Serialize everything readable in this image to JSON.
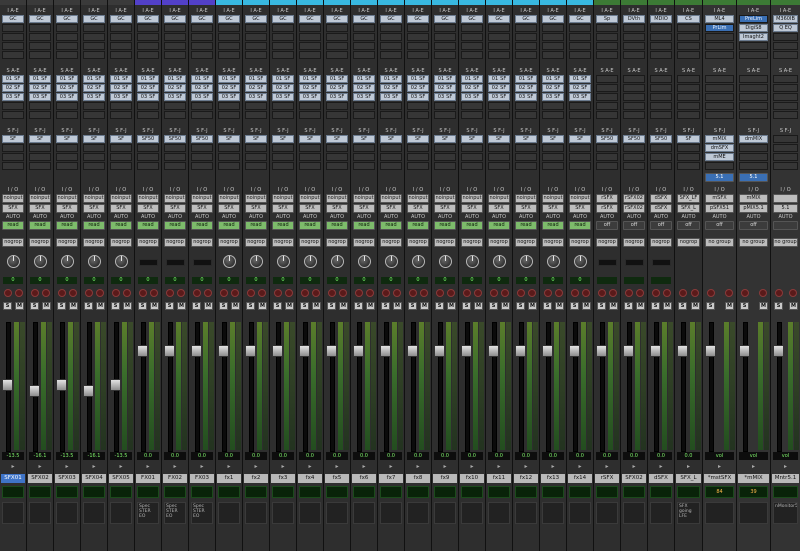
{
  "strips": [
    {
      "name": "SFX01",
      "color": "#3a3a3a",
      "selected": true,
      "inserts": [
        "GC",
        "",
        ""
      ],
      "sends_top": [
        "SF",
        "SF",
        "SF"
      ],
      "send_ids": [
        "01",
        "02",
        "03"
      ],
      "sendsF": [
        "SF"
      ],
      "input": "noinput",
      "output": "SFX",
      "auto": "AUTO",
      "mode": "read",
      "group": "nogrop",
      "pan": "0",
      "volume": "-13.5",
      "knob": true,
      "comment": ""
    },
    {
      "name": "SFX02",
      "color": "#3a3a3a",
      "inserts": [
        "GC",
        "",
        ""
      ],
      "sends_top": [
        "SF",
        "SF",
        "SF"
      ],
      "send_ids": [
        "01",
        "02",
        "03"
      ],
      "sendsF": [
        "SF"
      ],
      "input": "noinput",
      "output": "SFX",
      "auto": "AUTO",
      "mode": "read",
      "group": "nogrop",
      "pan": "0",
      "volume": "-16.1",
      "knob": true,
      "comment": ""
    },
    {
      "name": "SFX03",
      "color": "#3a3a3a",
      "inserts": [
        "GC",
        "",
        ""
      ],
      "sends_top": [
        "SF",
        "SF",
        "SF"
      ],
      "send_ids": [
        "01",
        "02",
        "03"
      ],
      "sendsF": [
        "SF"
      ],
      "input": "noinput",
      "output": "SFX",
      "auto": "AUTO",
      "mode": "read",
      "group": "nogrop",
      "pan": "0",
      "volume": "-13.5",
      "knob": true,
      "comment": ""
    },
    {
      "name": "SFX04",
      "color": "#3a3a3a",
      "inserts": [
        "GC",
        "",
        ""
      ],
      "sends_top": [
        "SF",
        "SF",
        "SF"
      ],
      "send_ids": [
        "01",
        "02",
        "03"
      ],
      "sendsF": [
        "SF"
      ],
      "input": "noinput",
      "output": "SFX",
      "auto": "AUTO",
      "mode": "read",
      "group": "nogrop",
      "pan": "0",
      "volume": "-16.1",
      "knob": true,
      "comment": ""
    },
    {
      "name": "SFX05",
      "color": "#3a3a3a",
      "inserts": [
        "GC",
        "",
        ""
      ],
      "sends_top": [
        "SF",
        "SF",
        "SF"
      ],
      "send_ids": [
        "01",
        "02",
        "03"
      ],
      "sendsF": [
        "SF"
      ],
      "input": "noinput",
      "output": "SFX",
      "auto": "AUTO",
      "mode": "read",
      "group": "nogrop",
      "pan": "0",
      "volume": "-13.5",
      "knob": true,
      "comment": ""
    },
    {
      "name": "FX01",
      "color": "#5240c8",
      "inserts": [
        "GC",
        "",
        ""
      ],
      "sends_top": [
        "SF",
        "SF",
        "SF"
      ],
      "send_ids": [
        "01",
        "02",
        "03"
      ],
      "sendsF": [
        "SF50"
      ],
      "input": "noinput",
      "output": "SFX",
      "auto": "AUTO",
      "mode": "read",
      "group": "nogrop",
      "pan": "0",
      "volume": "0.0",
      "knob": false,
      "comment": "Spec STER EO"
    },
    {
      "name": "FX02",
      "color": "#5240c8",
      "inserts": [
        "GC",
        "",
        ""
      ],
      "sends_top": [
        "SF",
        "SF",
        "SF"
      ],
      "send_ids": [
        "01",
        "02",
        "03"
      ],
      "sendsF": [
        "SF50"
      ],
      "input": "noinput",
      "output": "SFX",
      "auto": "AUTO",
      "mode": "read",
      "group": "nogrop",
      "pan": "0",
      "volume": "0.0",
      "knob": false,
      "comment": "Spec STER EO"
    },
    {
      "name": "FX03",
      "color": "#5240c8",
      "inserts": [
        "GC",
        "",
        ""
      ],
      "sends_top": [
        "SF",
        "SF",
        "SF"
      ],
      "send_ids": [
        "01",
        "02",
        "03"
      ],
      "sendsF": [
        "SF50"
      ],
      "input": "noinput",
      "output": "SFX",
      "auto": "AUTO",
      "mode": "read",
      "group": "nogrop",
      "pan": "0",
      "volume": "0.0",
      "knob": false,
      "comment": "Spec STER EO"
    },
    {
      "name": "fx1",
      "color": "#38b8e0",
      "inserts": [
        "GC",
        "",
        ""
      ],
      "sends_top": [
        "SF",
        "SF",
        "SF"
      ],
      "send_ids": [
        "01",
        "02",
        "03"
      ],
      "sendsF": [
        "SF"
      ],
      "input": "noinput",
      "output": "SFX",
      "auto": "AUTO",
      "mode": "read",
      "group": "nogrop",
      "pan": "0",
      "volume": "0.0",
      "knob": true,
      "comment": ""
    },
    {
      "name": "fx2",
      "color": "#38b8e0",
      "inserts": [
        "GC",
        "",
        ""
      ],
      "sends_top": [
        "SF",
        "SF",
        "SF"
      ],
      "send_ids": [
        "01",
        "02",
        "03"
      ],
      "sendsF": [
        "SF"
      ],
      "input": "noinput",
      "output": "SFX",
      "auto": "AUTO",
      "mode": "read",
      "group": "nogrop",
      "pan": "0",
      "volume": "0.0",
      "knob": true,
      "comment": ""
    },
    {
      "name": "fx3",
      "color": "#38b8e0",
      "inserts": [
        "GC",
        "",
        ""
      ],
      "sends_top": [
        "SF",
        "SF",
        "SF"
      ],
      "send_ids": [
        "01",
        "02",
        "03"
      ],
      "sendsF": [
        "SF"
      ],
      "input": "noinput",
      "output": "SFX",
      "auto": "AUTO",
      "mode": "read",
      "group": "nogrop",
      "pan": "0",
      "volume": "0.0",
      "knob": true,
      "comment": ""
    },
    {
      "name": "fx4",
      "color": "#38b8e0",
      "inserts": [
        "GC",
        "",
        ""
      ],
      "sends_top": [
        "SF",
        "SF",
        "SF"
      ],
      "send_ids": [
        "01",
        "02",
        "03"
      ],
      "sendsF": [
        "SF"
      ],
      "input": "noinput",
      "output": "SFX",
      "auto": "AUTO",
      "mode": "read",
      "group": "nogrop",
      "pan": "0",
      "volume": "0.0",
      "knob": true,
      "comment": ""
    },
    {
      "name": "fx5",
      "color": "#38b8e0",
      "inserts": [
        "GC",
        "",
        ""
      ],
      "sends_top": [
        "SF",
        "SF",
        "SF"
      ],
      "send_ids": [
        "01",
        "02",
        "03"
      ],
      "sendsF": [
        "SF"
      ],
      "input": "noinput",
      "output": "SFX",
      "auto": "AUTO",
      "mode": "read",
      "group": "nogrop",
      "pan": "0",
      "volume": "0.0",
      "knob": true,
      "comment": ""
    },
    {
      "name": "fx6",
      "color": "#38b8e0",
      "inserts": [
        "GC",
        "",
        ""
      ],
      "sends_top": [
        "SF",
        "SF",
        "SF"
      ],
      "send_ids": [
        "01",
        "02",
        "03"
      ],
      "sendsF": [
        "SF"
      ],
      "input": "noinput",
      "output": "SFX",
      "auto": "AUTO",
      "mode": "read",
      "group": "nogrop",
      "pan": "0",
      "volume": "0.0",
      "knob": true,
      "comment": ""
    },
    {
      "name": "fx7",
      "color": "#38b8e0",
      "inserts": [
        "GC",
        "",
        ""
      ],
      "sends_top": [
        "SF",
        "SF",
        "SF"
      ],
      "send_ids": [
        "01",
        "02",
        "03"
      ],
      "sendsF": [
        "SF"
      ],
      "input": "noinput",
      "output": "SFX",
      "auto": "AUTO",
      "mode": "read",
      "group": "nogrop",
      "pan": "0",
      "volume": "0.0",
      "knob": true,
      "comment": ""
    },
    {
      "name": "fx8",
      "color": "#38b8e0",
      "inserts": [
        "GC",
        "",
        ""
      ],
      "sends_top": [
        "SF",
        "SF",
        "SF"
      ],
      "send_ids": [
        "01",
        "02",
        "03"
      ],
      "sendsF": [
        "SF"
      ],
      "input": "noinput",
      "output": "SFX",
      "auto": "AUTO",
      "mode": "read",
      "group": "nogrop",
      "pan": "0",
      "volume": "0.0",
      "knob": true,
      "comment": ""
    },
    {
      "name": "fx9",
      "color": "#38b8e0",
      "inserts": [
        "GC",
        "",
        ""
      ],
      "sends_top": [
        "SF",
        "SF",
        "SF"
      ],
      "send_ids": [
        "01",
        "02",
        "03"
      ],
      "sendsF": [
        "SF"
      ],
      "input": "noinput",
      "output": "SFX",
      "auto": "AUTO",
      "mode": "read",
      "group": "nogrop",
      "pan": "0",
      "volume": "0.0",
      "knob": true,
      "comment": ""
    },
    {
      "name": "fx10",
      "color": "#38b8e0",
      "inserts": [
        "GC",
        "",
        ""
      ],
      "sends_top": [
        "SF",
        "SF",
        "SF"
      ],
      "send_ids": [
        "01",
        "02",
        "03"
      ],
      "sendsF": [
        "SF"
      ],
      "input": "noinput",
      "output": "SFX",
      "auto": "AUTO",
      "mode": "read",
      "group": "nogrop",
      "pan": "0",
      "volume": "0.0",
      "knob": true,
      "comment": ""
    },
    {
      "name": "fx11",
      "color": "#38b8e0",
      "inserts": [
        "GC",
        "",
        ""
      ],
      "sends_top": [
        "SF",
        "SF",
        "SF"
      ],
      "send_ids": [
        "01",
        "02",
        "03"
      ],
      "sendsF": [
        "SF"
      ],
      "input": "noinput",
      "output": "SFX",
      "auto": "AUTO",
      "mode": "read",
      "group": "nogrop",
      "pan": "0",
      "volume": "0.0",
      "knob": true,
      "comment": ""
    },
    {
      "name": "fx12",
      "color": "#38b8e0",
      "inserts": [
        "GC",
        "",
        ""
      ],
      "sends_top": [
        "SF",
        "SF",
        "SF"
      ],
      "send_ids": [
        "01",
        "02",
        "03"
      ],
      "sendsF": [
        "SF"
      ],
      "input": "noinput",
      "output": "SFX",
      "auto": "AUTO",
      "mode": "read",
      "group": "nogrop",
      "pan": "0",
      "volume": "0.0",
      "knob": true,
      "comment": ""
    },
    {
      "name": "fx13",
      "color": "#38b8e0",
      "inserts": [
        "GC",
        "",
        ""
      ],
      "sends_top": [
        "SF",
        "SF",
        "SF"
      ],
      "send_ids": [
        "01",
        "02",
        "03"
      ],
      "sendsF": [
        "SF"
      ],
      "input": "noinput",
      "output": "SFX",
      "auto": "AUTO",
      "mode": "read",
      "group": "nogrop",
      "pan": "0",
      "volume": "0.0",
      "knob": true,
      "comment": ""
    },
    {
      "name": "fx14",
      "color": "#38b8e0",
      "inserts": [
        "GC",
        "",
        ""
      ],
      "sends_top": [
        "SF",
        "SF",
        "SF"
      ],
      "send_ids": [
        "01",
        "02",
        "03"
      ],
      "sendsF": [
        "SF"
      ],
      "input": "noinput",
      "output": "SFX",
      "auto": "AUTO",
      "mode": "read",
      "group": "nogrop",
      "pan": "0",
      "volume": "0.0",
      "knob": true,
      "comment": ""
    },
    {
      "name": "rSFX",
      "color": "#3c7a35",
      "inserts": [
        "Sp",
        "",
        ""
      ],
      "sends_top": [
        "",
        "",
        ""
      ],
      "send_ids": [
        "",
        "",
        ""
      ],
      "sendsF": [
        "SF50"
      ],
      "input": "rSFX",
      "output": "rSFX",
      "auto": "AUTO",
      "mode": "off",
      "group": "nogrop",
      "pan": "",
      "volume": "0.0",
      "knob": false,
      "comment": ""
    },
    {
      "name": "SFX02",
      "color": "#3c7a35",
      "inserts": [
        "DVth",
        "",
        ""
      ],
      "sends_top": [
        "",
        "",
        ""
      ],
      "send_ids": [
        "",
        "",
        ""
      ],
      "sendsF": [
        "SF50"
      ],
      "input": "rSFX02",
      "output": "rSFX02",
      "auto": "AUTO",
      "mode": "off",
      "group": "nogrop",
      "pan": "",
      "volume": "0.0",
      "knob": false,
      "comment": ""
    },
    {
      "name": "dSFX",
      "color": "#3c7a35",
      "inserts": [
        "MDIO",
        "",
        ""
      ],
      "sends_top": [
        "",
        "",
        ""
      ],
      "send_ids": [
        "",
        "",
        ""
      ],
      "sendsF": [
        "SF50"
      ],
      "input": "dSFX",
      "output": "dSFX",
      "auto": "AUTO",
      "mode": "off",
      "group": "nogrop",
      "pan": "",
      "volume": "0.0",
      "knob": false,
      "comment": ""
    },
    {
      "name": "SFX_L",
      "color": "#3c7a35",
      "inserts": [
        "CS",
        "",
        ""
      ],
      "sends_top": [
        "",
        "",
        ""
      ],
      "send_ids": [
        "",
        "",
        ""
      ],
      "sendsF": [
        "SF"
      ],
      "input": "SFX_LF",
      "output": "SFX_L",
      "auto": "AUTO",
      "mode": "off",
      "group": "nogrop",
      "pan": "",
      "volume": "0.0",
      "knob": false,
      "comment": "SFX going LFE"
    },
    {
      "name": "*mstSFX",
      "color": "#3c7a35",
      "inserts": [
        "ML4",
        "PrLim",
        ""
      ],
      "sends_top": [
        "",
        "",
        ""
      ],
      "send_ids": [
        "",
        "",
        ""
      ],
      "sendsF": [
        "mMIX",
        "dmSFX",
        "mME"
      ],
      "input": "mSFX",
      "output": "pSFX51",
      "auto": "AUTO",
      "mode": "off",
      "group": "no group",
      "pan": "",
      "volume": "vol",
      "knob": false,
      "comment": "",
      "lcd": "84",
      "extra": "5.1"
    },
    {
      "name": "*mMIX",
      "color": "#3c7a35",
      "inserts": [
        "PreLim",
        "DigiS8",
        "Imaght2"
      ],
      "sends_top": [
        "",
        "",
        ""
      ],
      "send_ids": [
        "",
        "",
        ""
      ],
      "sendsF": [
        "dmMIX"
      ],
      "input": "mMIX",
      "output": "pMIX5.1",
      "auto": "AUTO",
      "mode": "off",
      "group": "no group",
      "pan": "",
      "volume": "vol",
      "knob": false,
      "comment": "",
      "lcd": "39",
      "extra": "5.1"
    },
    {
      "name": "Mntr5.1",
      "color": "#3c7a35",
      "inserts": [
        "M360IB",
        "Q EQ",
        ""
      ],
      "sends_top": [
        "",
        "",
        ""
      ],
      "send_ids": [
        "",
        "",
        ""
      ],
      "sendsF": [
        ""
      ],
      "input": "",
      "output": "5.1",
      "auto": "AUTO",
      "mode": "",
      "group": "no group",
      "pan": "",
      "volume": "vol",
      "knob": false,
      "comment": "nMonitor5.1_Film"
    }
  ],
  "labels": {
    "insert_hdr": "I A-E",
    "send_hdr": "S A-E",
    "sendF_hdr": "S F-J",
    "io_hdr": "I / O",
    "solo": "S",
    "mute": "M"
  }
}
